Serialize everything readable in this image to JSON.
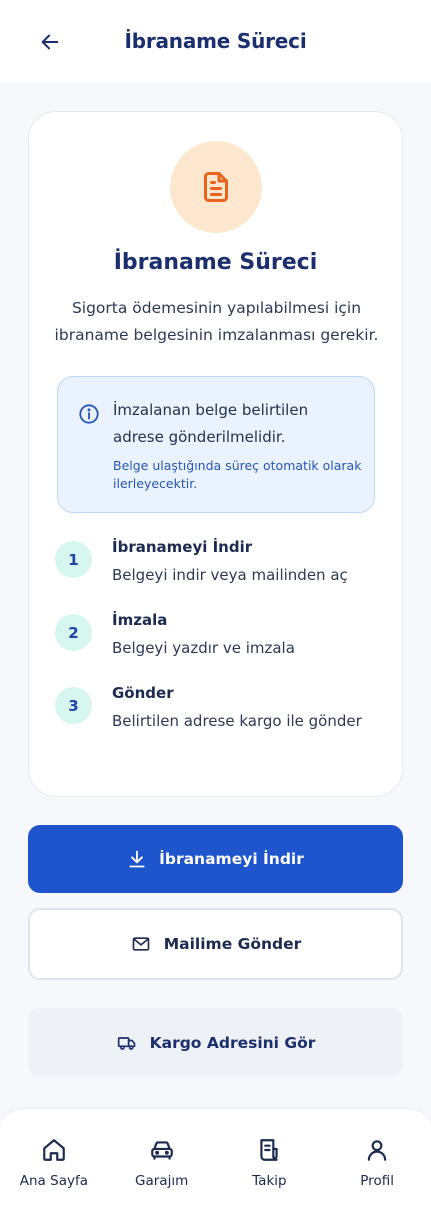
{
  "header": {
    "title": "İbraname Süreci",
    "back_icon": "arrow-left-icon"
  },
  "card": {
    "icon": "document-icon",
    "title": "İbraname Süreci",
    "description": "Sigorta ödemesinin yapılabilmesi için ibraname belgesinin imzalanması gerekir.",
    "info": {
      "icon": "info-icon",
      "main": "İmzalanan belge belirtilen adrese gönderilmelidir.",
      "sub": "Belge ulaştığında süreç otomatik olarak ilerleyecektir."
    },
    "steps": [
      {
        "number": "1",
        "title": "İbranameyi İndir",
        "description": "Belgeyi indir veya mailinden aç"
      },
      {
        "number": "2",
        "title": "İmzala",
        "description": "Belgeyi yazdır ve imzala"
      },
      {
        "number": "3",
        "title": "Gönder",
        "description": "Belirtilen adrese kargo ile gönder"
      }
    ]
  },
  "actions": {
    "download_label": "İbranameyi İndir",
    "download_icon": "download-icon",
    "mail_label": "Mailime Gönder",
    "mail_icon": "mail-icon",
    "cargo_label": "Kargo Adresini Gör",
    "cargo_icon": "truck-icon"
  },
  "nav": {
    "items": [
      {
        "label": "Ana Sayfa",
        "icon": "home-icon"
      },
      {
        "label": "Garajım",
        "icon": "car-icon"
      },
      {
        "label": "Takip",
        "icon": "receipt-icon"
      },
      {
        "label": "Profil",
        "icon": "user-icon"
      }
    ]
  },
  "colors": {
    "primary": "#1e55cc",
    "title": "#1b2f6e",
    "accent_orange": "#e8641c",
    "info_bg": "#eaf3fd",
    "step_bg": "#d6f6ef"
  }
}
